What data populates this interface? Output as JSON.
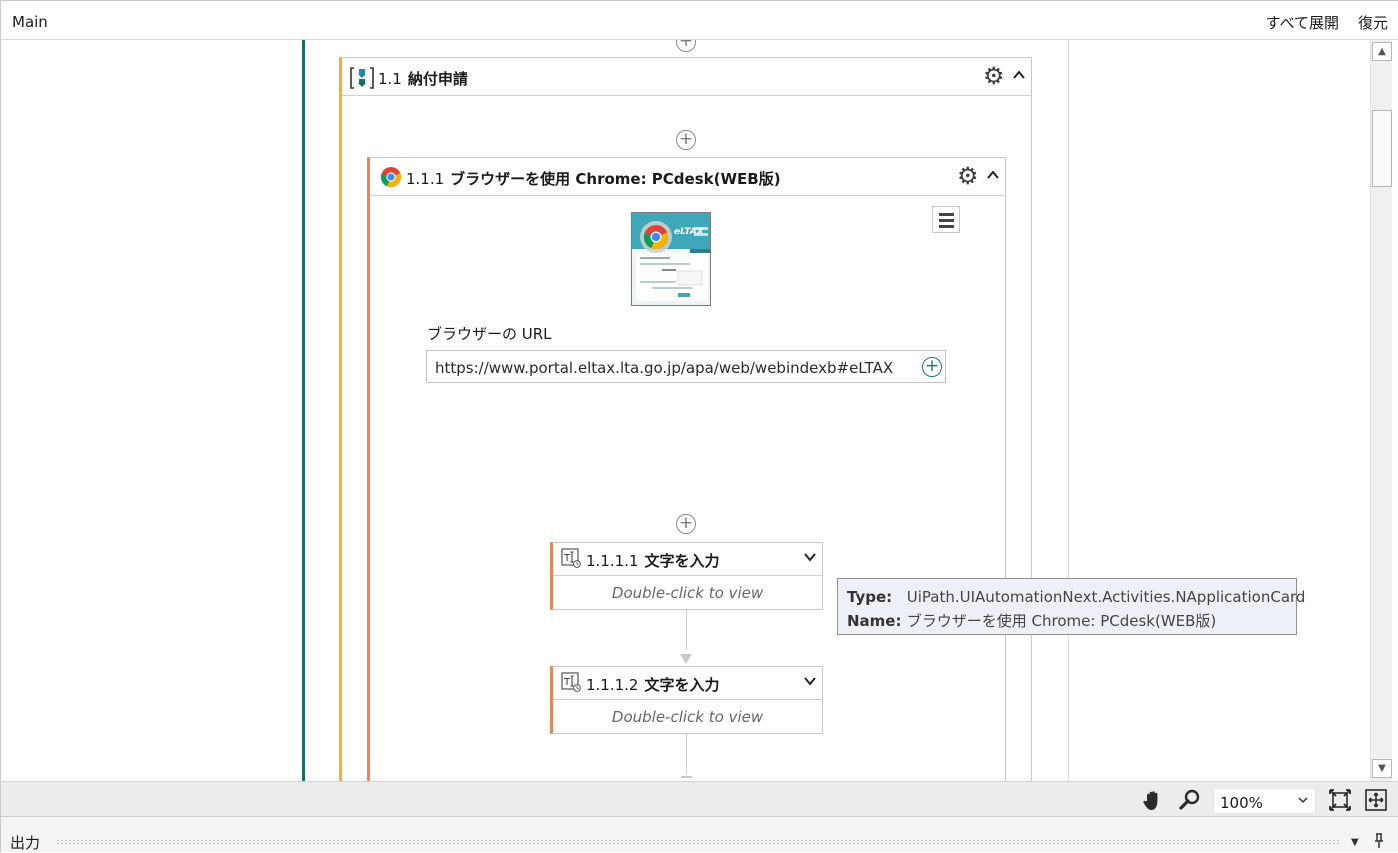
{
  "header": {
    "title": "Main",
    "expand_all_label": "すべて展開",
    "restore_label": "復元"
  },
  "sequence": {
    "number": "1.1",
    "name": "納付申請",
    "accent_color": "#f0b323",
    "icon": "sequence-icon"
  },
  "browser_scope": {
    "number": "1.1.1",
    "name": "ブラウザーを使用 Chrome: PCdesk(WEB版)",
    "accent_color": "#e8865a",
    "icon": "chrome-icon",
    "url_label": "ブラウザーの URL",
    "url_value": "https://www.portal.eltax.lta.go.jp/apa/web/webindexb#eLTAX",
    "thumbnail_text": "eLTAX"
  },
  "activities": [
    {
      "number": "1.1.1.1",
      "name": "文字を入力",
      "hint": "Double-click to view",
      "icon": "type-into-icon"
    },
    {
      "number": "1.1.1.2",
      "name": "文字を入力",
      "hint": "Double-click to view",
      "icon": "type-into-icon"
    }
  ],
  "tooltip": {
    "type_label": "Type:",
    "type_value": "UiPath.UIAutomationNext.Activities.NApplicationCard",
    "name_label": "Name:",
    "name_value": "ブラウザーを使用 Chrome: PCdesk(WEB版)"
  },
  "toolbar": {
    "zoom": "100%",
    "icons": [
      "hand-pan-icon",
      "zoom-magnifier-icon",
      "fit-to-screen-icon",
      "overview-icon"
    ]
  },
  "output_panel": {
    "title": "出力"
  },
  "colors": {
    "sequence_line": "#1b6e68",
    "tooltip_bg": "#edf0f6"
  }
}
